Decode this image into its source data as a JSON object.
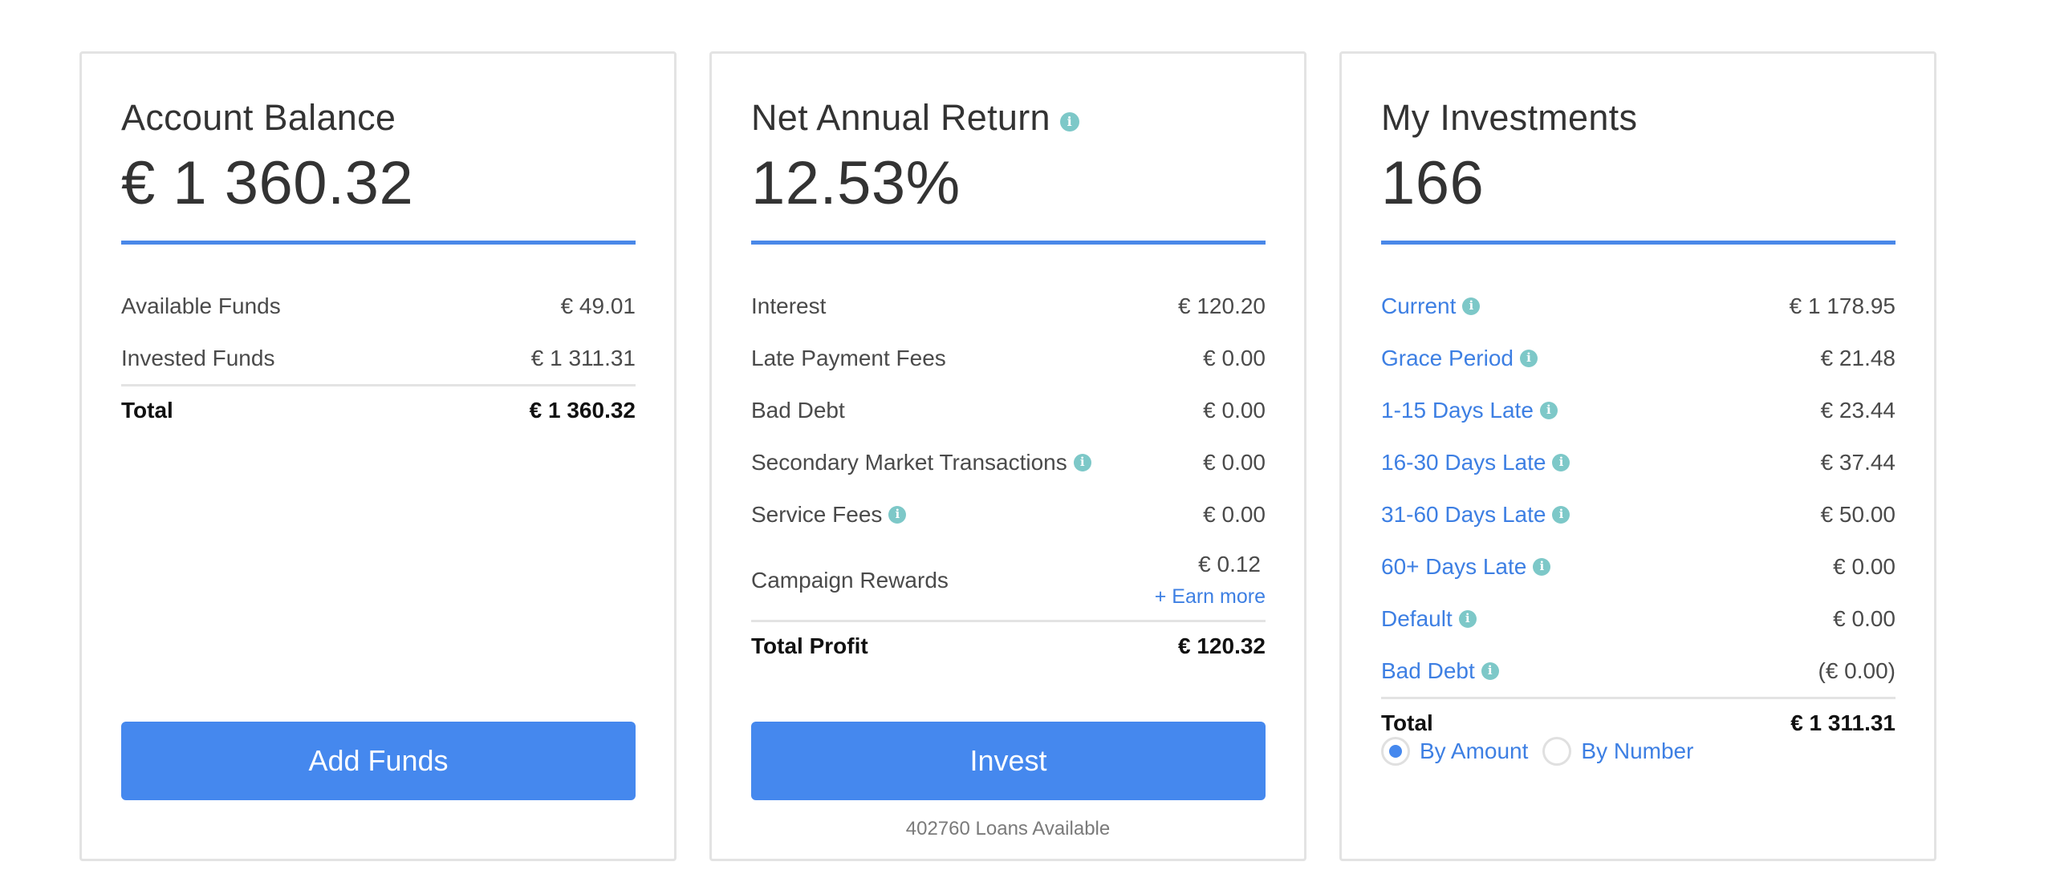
{
  "colors": {
    "accent": "#4588ee",
    "link": "#3d7fe3",
    "info_icon": "#7dc8c8",
    "card_border": "#e3e3e3"
  },
  "account_balance": {
    "title": "Account Balance",
    "amount": "€ 1 360.32",
    "rows": [
      {
        "label": "Available Funds",
        "value": "€ 49.01"
      },
      {
        "label": "Invested Funds",
        "value": "€ 1 311.31"
      }
    ],
    "total": {
      "label": "Total",
      "value": "€ 1 360.32"
    },
    "button_label": "Add Funds"
  },
  "net_annual_return": {
    "title": "Net Annual Return",
    "title_icon": "info-icon",
    "amount": "12.53%",
    "rows": [
      {
        "label": "Interest",
        "value": "€ 120.20",
        "info": false
      },
      {
        "label": "Late Payment Fees",
        "value": "€ 0.00",
        "info": false
      },
      {
        "label": "Bad Debt",
        "value": "€ 0.00",
        "info": false
      },
      {
        "label": "Secondary Market Transactions",
        "value": "€ 0.00",
        "info": true
      },
      {
        "label": "Service Fees",
        "value": "€ 0.00",
        "info": true
      }
    ],
    "campaign": {
      "label": "Campaign Rewards",
      "value": "€ 0.12",
      "link": "+ Earn more"
    },
    "total": {
      "label": "Total Profit",
      "value": "€ 120.32"
    },
    "button_label": "Invest",
    "loans_available": "402760 Loans Available"
  },
  "my_investments": {
    "title": "My Investments",
    "amount": "166",
    "rows": [
      {
        "label": "Current",
        "value": "€ 1 178.95"
      },
      {
        "label": "Grace Period",
        "value": "€ 21.48"
      },
      {
        "label": "1-15 Days Late",
        "value": "€ 23.44"
      },
      {
        "label": "16-30 Days Late",
        "value": "€ 37.44"
      },
      {
        "label": "31-60 Days Late",
        "value": "€ 50.00"
      },
      {
        "label": "60+ Days Late",
        "value": "€ 0.00"
      },
      {
        "label": "Default",
        "value": "€ 0.00"
      },
      {
        "label": "Bad Debt",
        "value": "(€ 0.00)"
      }
    ],
    "total": {
      "label": "Total",
      "value": "€ 1 311.31"
    },
    "view_mode": {
      "options": [
        "By Amount",
        "By Number"
      ],
      "selected": "By Amount"
    }
  },
  "icons": {
    "info": "i"
  }
}
